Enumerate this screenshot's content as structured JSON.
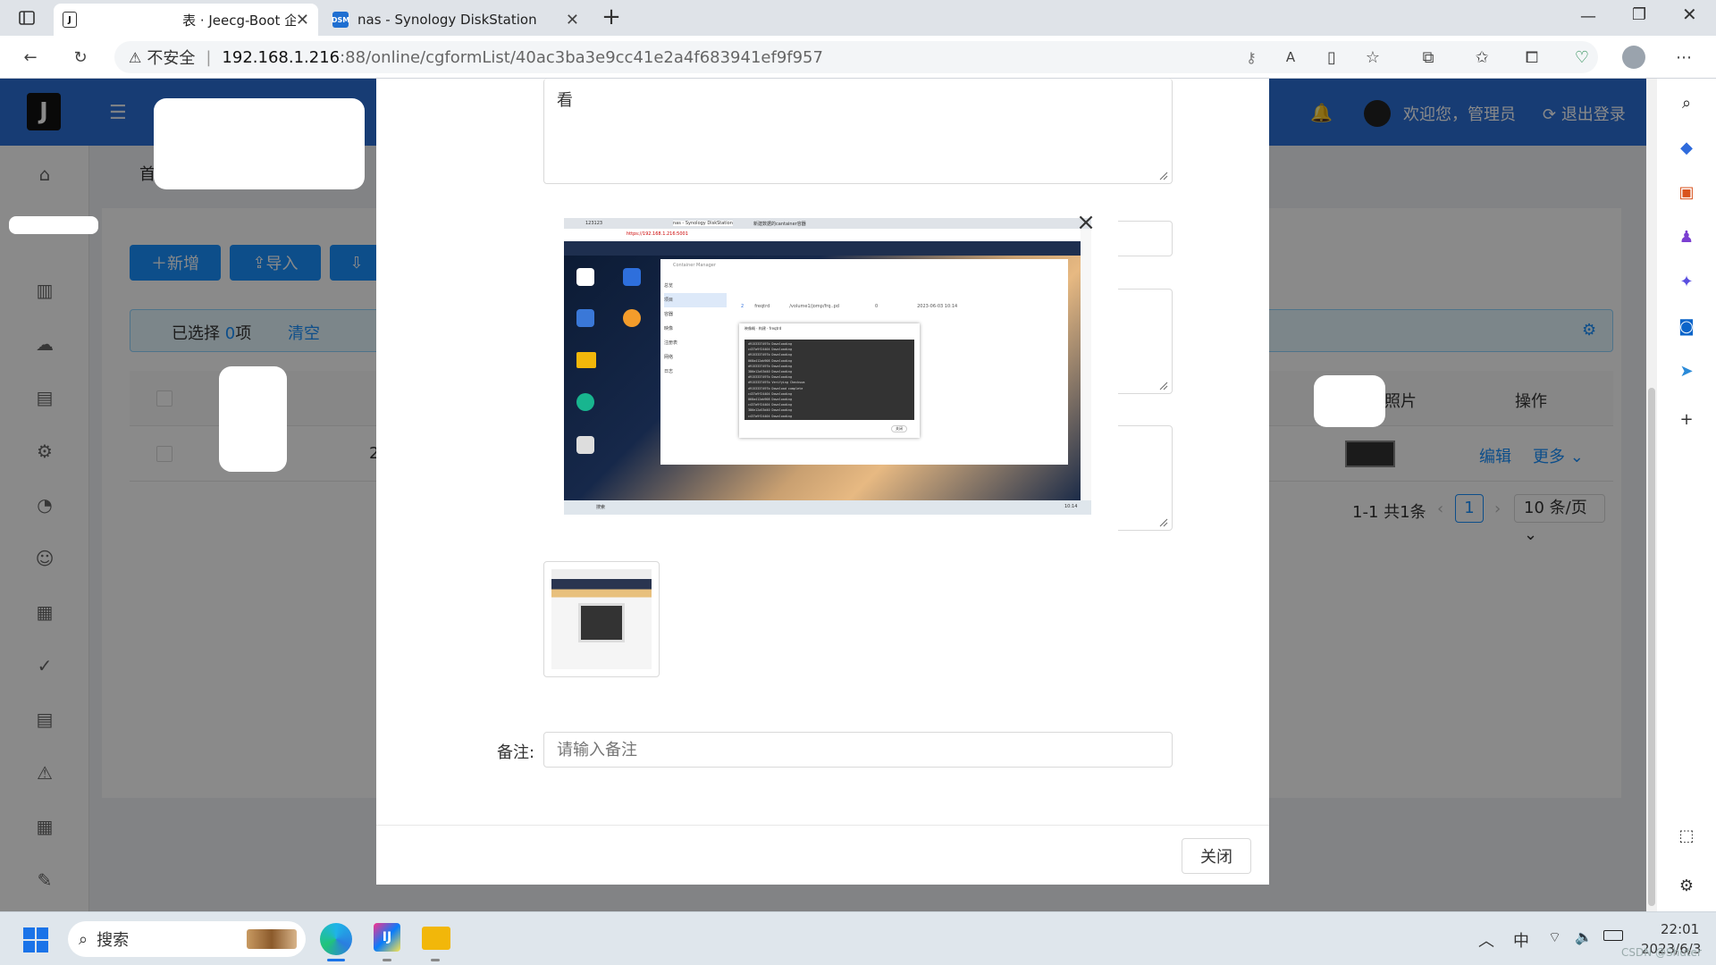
{
  "browser": {
    "tabs": [
      {
        "title": "表 · Jeecg-Boot 企业",
        "favicon": "J",
        "active": true
      },
      {
        "title": "nas - Synology DiskStation",
        "favicon": "DSM",
        "active": false
      }
    ],
    "new_tab": "+",
    "url": {
      "warning": "不安全",
      "host": "192.168.1.216",
      "path": ":88/online/cgformList/40ac3ba3e9cc41e2a4f683941ef9f957"
    },
    "window_controls": [
      "minimize",
      "restore",
      "close"
    ]
  },
  "app": {
    "header": {
      "welcome": "欢迎您，管理员",
      "logout": "退出登录"
    },
    "tab_home": "首",
    "toolbar": {
      "add": "新增",
      "import": "导入"
    },
    "selection": {
      "prefix": "已选择",
      "count": "0",
      "suffix": "项",
      "clear": "清空"
    },
    "table": {
      "columns": [
        "照片",
        "操作"
      ],
      "row_prefix": "2",
      "actions": {
        "edit": "编辑",
        "more": "更多"
      }
    },
    "pagination": {
      "summary": "1-1 共1条",
      "current_page": "1",
      "page_size": "10 条/页"
    }
  },
  "modal": {
    "top_field_prefix": "看",
    "remark_label": "备注:",
    "remark_placeholder": "请输入备注",
    "close": "关闭"
  },
  "preview": {
    "close": "×",
    "inner": {
      "tabs": [
        "123123",
        "nas - Synology DiskStation",
        "新建数据的cantainer容器"
      ],
      "url": "https://192.168.1.216:5001",
      "window_title": "Container Manager",
      "menu": [
        "总览",
        "项目",
        "容器",
        "映像",
        "注册表",
        "网络",
        "日志"
      ],
      "project_row": [
        "2",
        "freqtrd",
        "/volume1/jomp/frq..pd",
        "0",
        "2023-06-03 10:14"
      ],
      "dialog_title": "映像概 · 构建 · freqtrd",
      "log_lines": [
        "d9153337497b Downloading",
        "c437a9f24404 Downloading",
        "d9153337497b Downloading",
        "068a412ab908 Downloading",
        "d9153337497b Downloading",
        "386e12a53d40 Downloading",
        "d9153337497b Downloading",
        "d9153337497b Verifying Checksum",
        "d9153337497b Download complete",
        "c437a9f24404 Downloading",
        "068a412ab908 Downloading",
        "c437a9f24404 Downloading",
        "386e12a53d40 Downloading",
        "c437a9f24404 Downloading"
      ],
      "dialog_button": "关闭",
      "desktop_icons": [
        "套件中心",
        "Synology Drive",
        "控制面板",
        "Synology Photos",
        "File Station",
        "DSM 帮助",
        "Synology Drive 管理控制台"
      ],
      "taskbar_search": "搜索",
      "clock": "10:14"
    }
  },
  "taskbar": {
    "search": "搜索",
    "ime": "中",
    "time": "22:01",
    "date": "2023/6/3",
    "watermark": "CSDN @Shuter"
  },
  "colors": {
    "primary": "#1890ff",
    "header": "#2b6fd6",
    "overlay": "rgba(0,0,0,0.46)"
  }
}
